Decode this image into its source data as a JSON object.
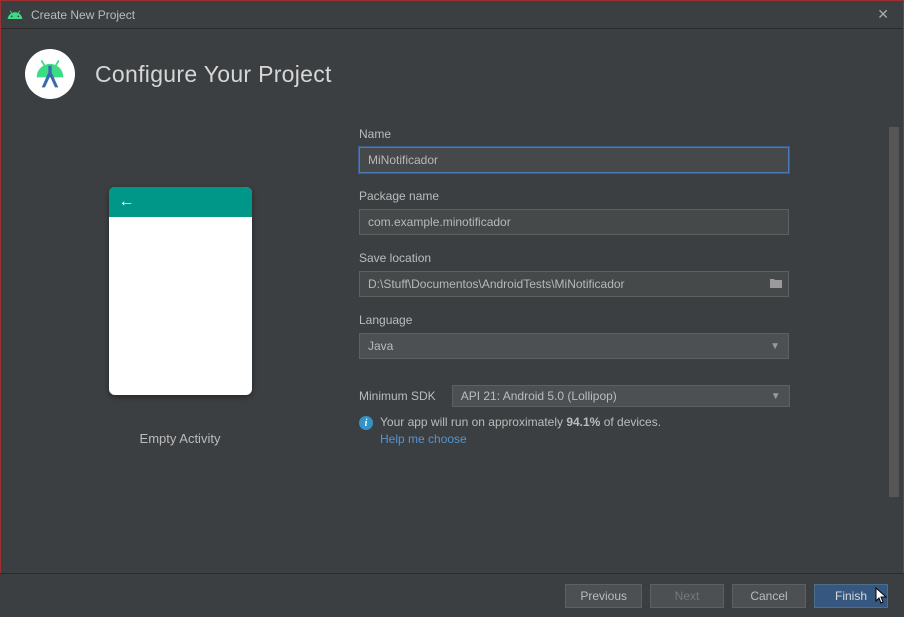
{
  "window": {
    "title": "Create New Project"
  },
  "header": {
    "title": "Configure Your Project"
  },
  "preview": {
    "label": "Empty Activity"
  },
  "form": {
    "name": {
      "label": "Name",
      "value": "MiNotificador"
    },
    "package": {
      "label": "Package name",
      "value": "com.example.minotificador"
    },
    "save_location": {
      "label": "Save location",
      "value": "D:\\Stuff\\Documentos\\AndroidTests\\MiNotificador"
    },
    "language": {
      "label": "Language",
      "value": "Java"
    },
    "min_sdk": {
      "label": "Minimum SDK",
      "value": "API 21: Android 5.0 (Lollipop)"
    }
  },
  "info": {
    "prefix": "Your app will run on approximately ",
    "percent": "94.1%",
    "suffix": " of devices.",
    "help_link": "Help me choose"
  },
  "buttons": {
    "previous": "Previous",
    "next": "Next",
    "cancel": "Cancel",
    "finish": "Finish"
  }
}
